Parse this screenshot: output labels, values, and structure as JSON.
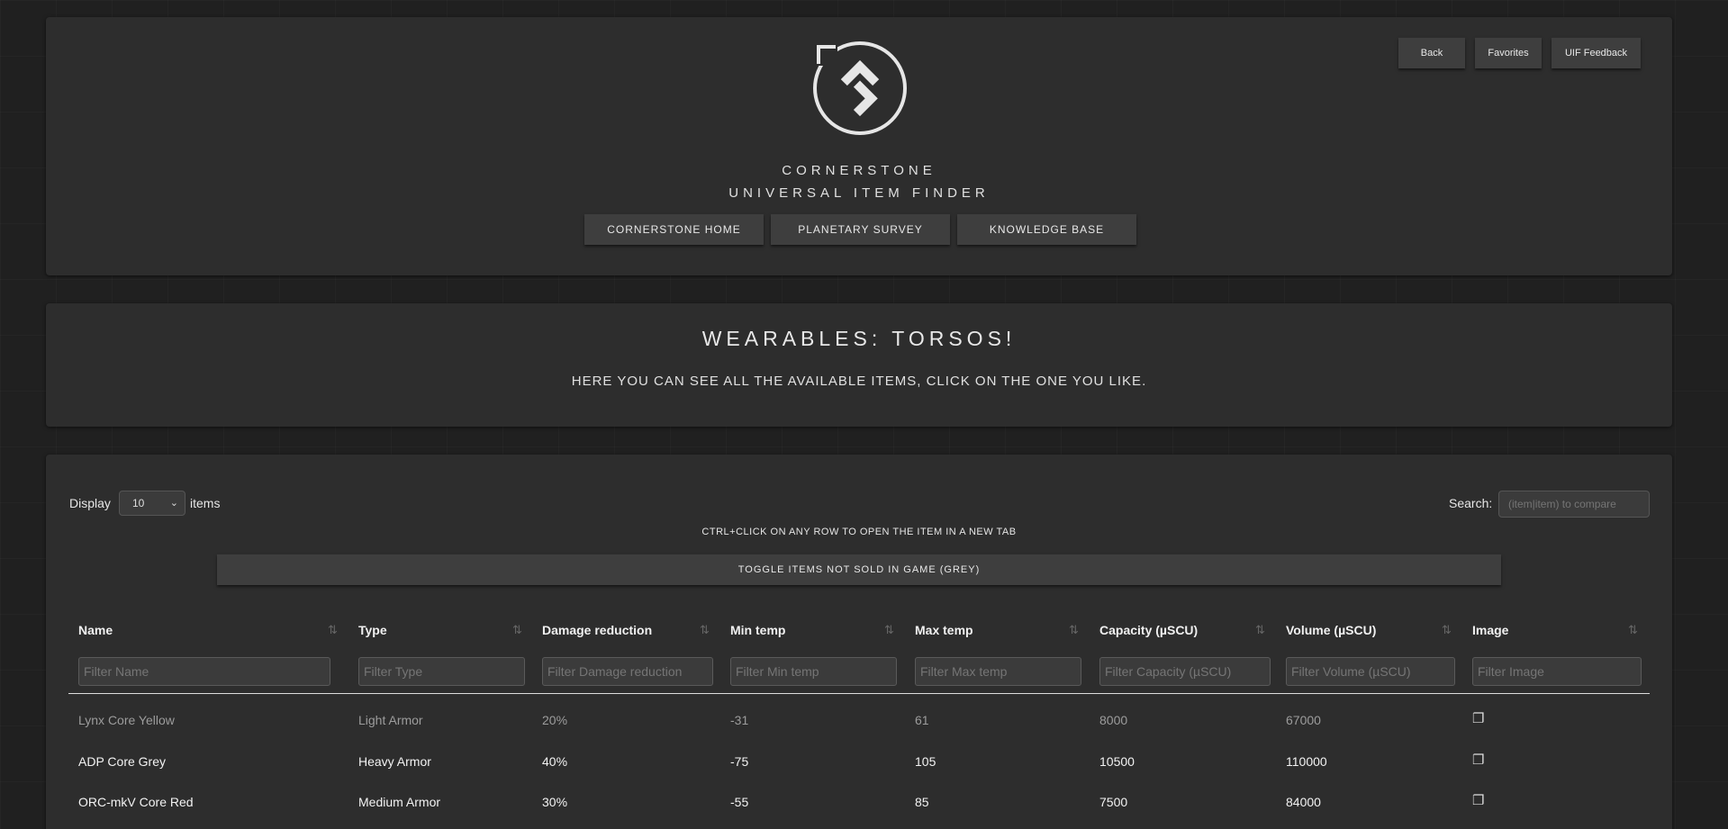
{
  "header": {
    "brand_title": "CORNERSTONE",
    "brand_subtitle": "UNIVERSAL ITEM FINDER",
    "nav": [
      "CORNERSTONE HOME",
      "PLANETARY SURVEY",
      "KNOWLEDGE BASE"
    ],
    "top_buttons": {
      "back": "Back",
      "favorites": "Favorites",
      "feedback": "UIF Feedback"
    }
  },
  "intro": {
    "title": "WEARABLES: TORSOS!",
    "subtitle": "HERE YOU CAN SEE ALL THE AVAILABLE ITEMS, CLICK ON THE ONE YOU LIKE."
  },
  "table_controls": {
    "display_label": "Display",
    "display_value": "10",
    "items_label": "items",
    "search_label": "Search:",
    "search_placeholder": "(item|item) to compare",
    "ctrl_note": "CTRL+CLICK ON ANY ROW TO OPEN THE ITEM IN A NEW TAB",
    "toggle_label": "TOGGLE ITEMS NOT SOLD IN GAME (GREY)"
  },
  "columns": [
    {
      "label": "Name",
      "filter": "Filter Name"
    },
    {
      "label": "Type",
      "filter": "Filter Type"
    },
    {
      "label": "Damage reduction",
      "filter": "Filter Damage reduction"
    },
    {
      "label": "Min temp",
      "filter": "Filter Min temp"
    },
    {
      "label": "Max temp",
      "filter": "Filter Max temp"
    },
    {
      "label": "Capacity (µSCU)",
      "filter": "Filter Capacity (µSCU)"
    },
    {
      "label": "Volume (µSCU)",
      "filter": "Filter Volume (µSCU)"
    },
    {
      "label": "Image",
      "filter": "Filter Image"
    }
  ],
  "rows": [
    {
      "name": "Lynx Core Yellow",
      "type": "Light Armor",
      "damage": "20%",
      "min": "-31",
      "max": "61",
      "capacity": "8000",
      "volume": "67000",
      "image": "❐",
      "greyed": true
    },
    {
      "name": "ADP Core Grey",
      "type": "Heavy Armor",
      "damage": "40%",
      "min": "-75",
      "max": "105",
      "capacity": "10500",
      "volume": "110000",
      "image": "❐",
      "greyed": false
    },
    {
      "name": "ORC-mkV Core Red",
      "type": "Medium Armor",
      "damage": "30%",
      "min": "-55",
      "max": "85",
      "capacity": "7500",
      "volume": "84000",
      "image": "❐",
      "greyed": false
    }
  ],
  "icons": {
    "sort": "sort-arrows-icon",
    "image": "image-copy-icon",
    "select": "chevron-down-icon",
    "logo": "cornerstone-logo-icon"
  },
  "colors": {
    "panel": "#2d2d2d",
    "button": "#3e3e3e",
    "greyed_text": "#9c9c9c"
  }
}
